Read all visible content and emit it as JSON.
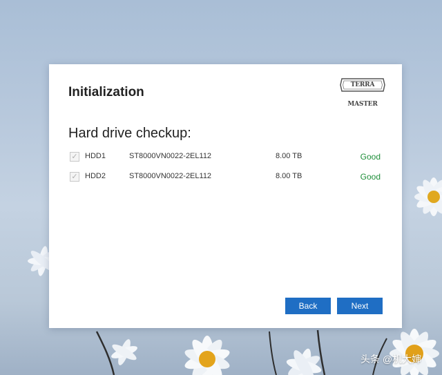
{
  "dialog": {
    "title": "Initialization",
    "logo_text": "TERRA MASTER",
    "section_heading": "Hard drive checkup:",
    "drives": [
      {
        "checked": true,
        "name": "HDD1",
        "model": "ST8000VN0022-2EL112",
        "size": "8.00 TB",
        "status": "Good"
      },
      {
        "checked": true,
        "name": "HDD2",
        "model": "ST8000VN0022-2EL112",
        "size": "8.00 TB",
        "status": "Good"
      }
    ],
    "back_label": "Back",
    "next_label": "Next"
  },
  "watermark": "头条 @机大婶",
  "colors": {
    "accent": "#1f6ec4",
    "status_good": "#1f8f3a",
    "desktop_top": "#a9bed6",
    "desktop_bottom": "#9fb1c6"
  }
}
